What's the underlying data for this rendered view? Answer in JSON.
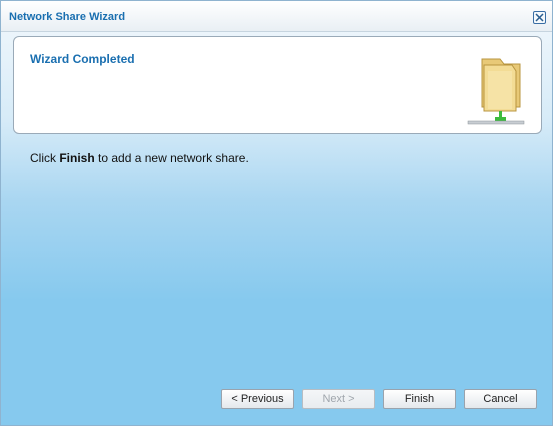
{
  "window": {
    "title": "Network Share Wizard"
  },
  "header": {
    "title": "Wizard Completed"
  },
  "message": {
    "prefix": "Click ",
    "bold": "Finish",
    "suffix": " to add a new network share."
  },
  "buttons": {
    "previous": "< Previous",
    "next": "Next >",
    "finish": "Finish",
    "cancel": "Cancel"
  },
  "icons": {
    "close": "close-icon",
    "wizard": "network-share-folder-icon"
  },
  "colors": {
    "title": "#1a6fb0",
    "background_bottom": "#86c9ee",
    "accent_green": "#3dbb3d"
  }
}
